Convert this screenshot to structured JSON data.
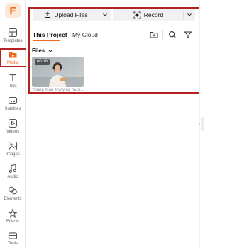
{
  "logo": {
    "letter": "F"
  },
  "sidebar": {
    "items": [
      {
        "label": "Templates",
        "icon": "templates-icon"
      },
      {
        "label": "Media",
        "icon": "media-folder-icon",
        "active": true
      },
      {
        "label": "Text",
        "icon": "text-icon"
      },
      {
        "label": "Subtitles",
        "icon": "subtitles-icon"
      },
      {
        "label": "Videos",
        "icon": "videos-icon"
      },
      {
        "label": "Images",
        "icon": "images-icon"
      },
      {
        "label": "Audio",
        "icon": "audio-icon"
      },
      {
        "label": "Elements",
        "icon": "elements-icon"
      },
      {
        "label": "Effects",
        "icon": "effects-icon"
      },
      {
        "label": "Tools",
        "icon": "tools-icon"
      }
    ]
  },
  "toolbar": {
    "upload_label": "Upload Files",
    "record_label": "Record"
  },
  "tabs": [
    {
      "label": "This Project",
      "active": true
    },
    {
      "label": "My Cloud",
      "active": false
    }
  ],
  "files": {
    "label": "Files",
    "items": [
      {
        "duration": "00:18",
        "caption": "Young man enjoying musi..."
      }
    ]
  },
  "colors": {
    "accent": "#f26b1d",
    "highlight_frame": "#b32121",
    "button_bg": "#f1f1f3"
  }
}
